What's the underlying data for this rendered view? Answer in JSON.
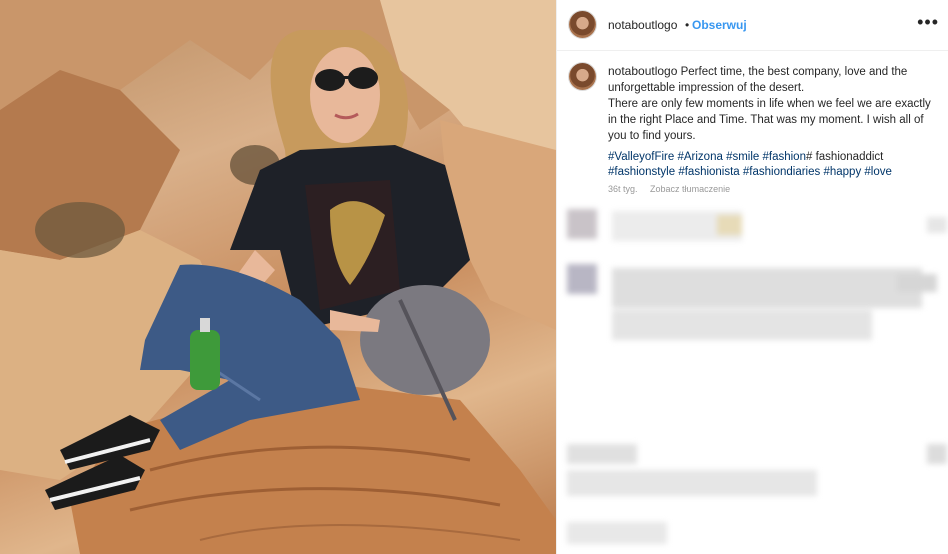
{
  "post": {
    "username": "notaboutlogo",
    "dot": "•",
    "follow_label": "Obserwuj",
    "more_label": "•••"
  },
  "caption": {
    "username": "notaboutlogo",
    "line1": "Perfect time, the best company, love and the unforgettable impression of the desert.",
    "line2": "There are only few moments in life when we feel we are exactly in the right Place and Time. That was my moment. I wish all of you to find yours.",
    "tags": [
      "#ValleyofFire",
      "#Arizona",
      "#smile",
      "#fashion",
      "fashionaddict",
      "#fashionstyle",
      "#fashionista",
      "#fashiondiaries",
      "#happy",
      "#love"
    ],
    "tag_separator_after_fashion": "#",
    "time": "36t tyg.",
    "translate": "Zobacz tłumaczenie"
  },
  "icons": {
    "avatar": "profile-photo",
    "more": "ellipsis-icon"
  },
  "colors": {
    "link": "#3897f0",
    "hashtag": "#003569",
    "text": "#262626"
  }
}
